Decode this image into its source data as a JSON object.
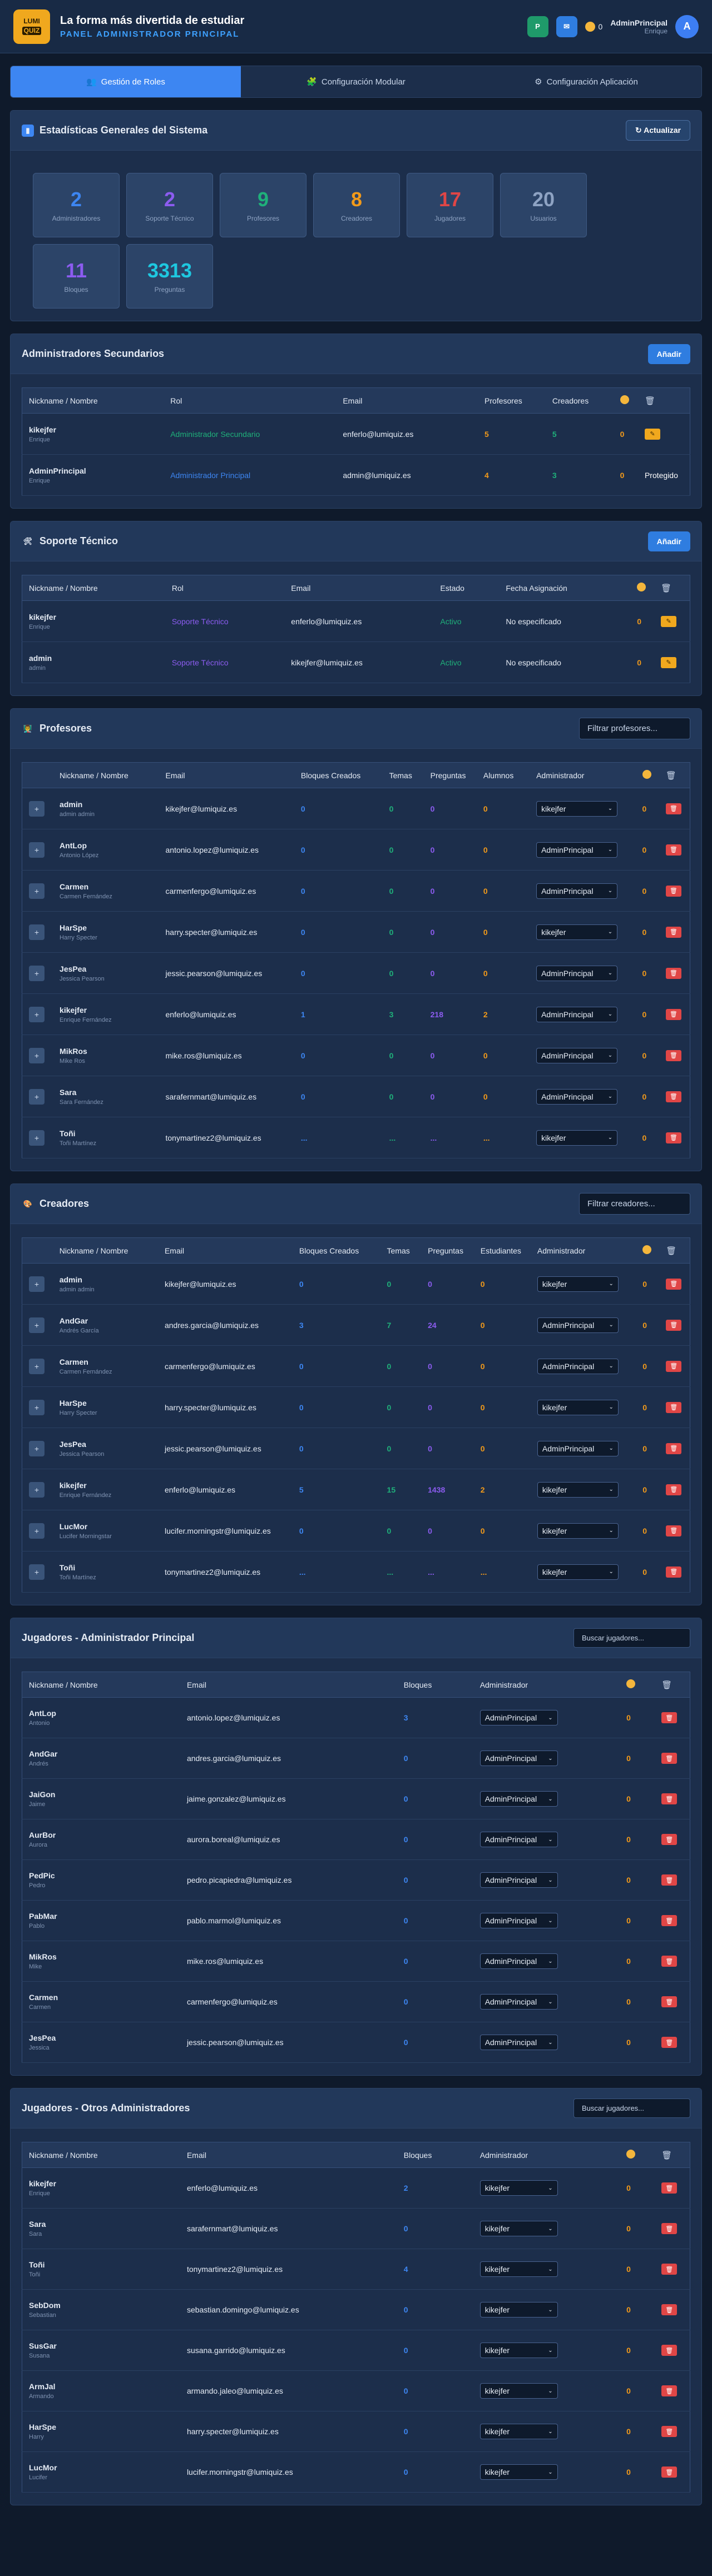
{
  "header": {
    "logo_line1": "LUMI",
    "logo_line2": "QUIZ",
    "slogan": "La forma más divertida de estudiar",
    "panel_label": "PANEL ADMINISTRADOR PRINCIPAL",
    "coins": "0",
    "user_name": "AdminPrincipal",
    "user_role": "Enrique",
    "avatar_letter": "A"
  },
  "tabs": [
    {
      "label": "Gestión de Roles",
      "icon": "users-icon"
    },
    {
      "label": "Configuración Modular",
      "icon": "modules-icon"
    },
    {
      "label": "Configuración Aplicación",
      "icon": "gear-icon"
    }
  ],
  "stats": {
    "title": "Estadísticas Generales del Sistema",
    "refresh": "Actualizar",
    "items": [
      {
        "value": "2",
        "label": "Administradores",
        "color": "#3d86f2"
      },
      {
        "value": "2",
        "label": "Soporte Técnico",
        "color": "#8c5cf0"
      },
      {
        "value": "9",
        "label": "Profesores",
        "color": "#1fb07a"
      },
      {
        "value": "8",
        "label": "Creadores",
        "color": "#f29a1a"
      },
      {
        "value": "17",
        "label": "Jugadores",
        "color": "#e04646"
      },
      {
        "value": "20",
        "label": "Usuarios",
        "color": "#8ea3c3"
      },
      {
        "value": "11",
        "label": "Bloques",
        "color": "#8c5cf0"
      },
      {
        "value": "3313",
        "label": "Preguntas",
        "color": "#1ec8e0"
      }
    ]
  },
  "admins": {
    "title": "Administradores Secundarios",
    "add": "Añadir",
    "cols": [
      "Nickname / Nombre",
      "Rol",
      "Email",
      "Profesores",
      "Creadores",
      "",
      ""
    ],
    "rows": [
      {
        "nick": "kikejfer",
        "name": "Enrique",
        "role": "Administrador Secundario",
        "email": "enferlo@lumiquiz.es",
        "prof": "5",
        "crea": "5",
        "coins": "0",
        "action": "edit"
      },
      {
        "nick": "AdminPrincipal",
        "name": "Enrique",
        "role": "Administrador Principal",
        "email": "admin@lumiquiz.es",
        "prof": "4",
        "crea": "3",
        "coins": "0",
        "action": "Protegido"
      }
    ]
  },
  "support": {
    "title": "Soporte Técnico",
    "add": "Añadir",
    "cols": [
      "Nickname / Nombre",
      "Rol",
      "Email",
      "Estado",
      "Fecha Asignación",
      "",
      ""
    ],
    "rows": [
      {
        "nick": "kikejfer",
        "name": "Enrique",
        "role": "Soporte Técnico",
        "email": "enferlo@lumiquiz.es",
        "state": "Activo",
        "date": "No especificado",
        "coins": "0"
      },
      {
        "nick": "admin",
        "name": "admin",
        "role": "Soporte Técnico",
        "email": "kikejfer@lumiquiz.es",
        "state": "Activo",
        "date": "No especificado",
        "coins": "0"
      }
    ]
  },
  "teachers": {
    "title": "Profesores",
    "filter": "Filtrar profesores...",
    "cols": [
      "",
      "Nickname / Nombre",
      "Email",
      "Bloques Creados",
      "Temas",
      "Preguntas",
      "Alumnos",
      "Administrador",
      "",
      ""
    ],
    "rows": [
      {
        "nick": "admin",
        "name": "admin admin",
        "email": "kikejfer@lumiquiz.es",
        "blocks": "0",
        "temas": "0",
        "preg": "0",
        "alum": "0",
        "admin": "kikejfer",
        "coins": "0"
      },
      {
        "nick": "AntLop",
        "name": "Antonio López",
        "email": "antonio.lopez@lumiquiz.es",
        "blocks": "0",
        "temas": "0",
        "preg": "0",
        "alum": "0",
        "admin": "AdminPrincipal",
        "coins": "0"
      },
      {
        "nick": "Carmen",
        "name": "Carmen Fernández",
        "email": "carmenfergo@lumiquiz.es",
        "blocks": "0",
        "temas": "0",
        "preg": "0",
        "alum": "0",
        "admin": "AdminPrincipal",
        "coins": "0"
      },
      {
        "nick": "HarSpe",
        "name": "Harry Specter",
        "email": "harry.specter@lumiquiz.es",
        "blocks": "0",
        "temas": "0",
        "preg": "0",
        "alum": "0",
        "admin": "kikejfer",
        "coins": "0"
      },
      {
        "nick": "JesPea",
        "name": "Jessica Pearson",
        "email": "jessic.pearson@lumiquiz.es",
        "blocks": "0",
        "temas": "0",
        "preg": "0",
        "alum": "0",
        "admin": "AdminPrincipal",
        "coins": "0"
      },
      {
        "nick": "kikejfer",
        "name": "Enrique Fernández",
        "email": "enferlo@lumiquiz.es",
        "blocks": "1",
        "temas": "3",
        "preg": "218",
        "alum": "2",
        "admin": "AdminPrincipal",
        "coins": "0"
      },
      {
        "nick": "MikRos",
        "name": "Mike Ros",
        "email": "mike.ros@lumiquiz.es",
        "blocks": "0",
        "temas": "0",
        "preg": "0",
        "alum": "0",
        "admin": "AdminPrincipal",
        "coins": "0"
      },
      {
        "nick": "Sara",
        "name": "Sara Fernández",
        "email": "sarafernmart@lumiquiz.es",
        "blocks": "0",
        "temas": "0",
        "preg": "0",
        "alum": "0",
        "admin": "AdminPrincipal",
        "coins": "0"
      },
      {
        "nick": "Toñi",
        "name": "Toñi Martínez",
        "email": "tonymartinez2@lumiquiz.es",
        "blocks": "...",
        "temas": "...",
        "preg": "...",
        "alum": "...",
        "admin": "kikejfer",
        "coins": "0"
      }
    ]
  },
  "creators": {
    "title": "Creadores",
    "filter": "Filtrar creadores...",
    "cols": [
      "",
      "Nickname / Nombre",
      "Email",
      "Bloques Creados",
      "Temas",
      "Preguntas",
      "Estudiantes",
      "Administrador",
      "",
      ""
    ],
    "rows": [
      {
        "nick": "admin",
        "name": "admin admin",
        "email": "kikejfer@lumiquiz.es",
        "blocks": "0",
        "temas": "0",
        "preg": "0",
        "alum": "0",
        "admin": "kikejfer",
        "coins": "0"
      },
      {
        "nick": "AndGar",
        "name": "Andrés García",
        "email": "andres.garcia@lumiquiz.es",
        "blocks": "3",
        "temas": "7",
        "preg": "24",
        "alum": "0",
        "admin": "AdminPrincipal",
        "coins": "0"
      },
      {
        "nick": "Carmen",
        "name": "Carmen Fernández",
        "email": "carmenfergo@lumiquiz.es",
        "blocks": "0",
        "temas": "0",
        "preg": "0",
        "alum": "0",
        "admin": "AdminPrincipal",
        "coins": "0"
      },
      {
        "nick": "HarSpe",
        "name": "Harry Specter",
        "email": "harry.specter@lumiquiz.es",
        "blocks": "0",
        "temas": "0",
        "preg": "0",
        "alum": "0",
        "admin": "kikejfer",
        "coins": "0"
      },
      {
        "nick": "JesPea",
        "name": "Jessica Pearson",
        "email": "jessic.pearson@lumiquiz.es",
        "blocks": "0",
        "temas": "0",
        "preg": "0",
        "alum": "0",
        "admin": "AdminPrincipal",
        "coins": "0"
      },
      {
        "nick": "kikejfer",
        "name": "Enrique Fernández",
        "email": "enferlo@lumiquiz.es",
        "blocks": "5",
        "temas": "15",
        "preg": "1438",
        "alum": "2",
        "admin": "kikejfer",
        "coins": "0"
      },
      {
        "nick": "LucMor",
        "name": "Lucifer Morningstar",
        "email": "lucifer.morningstr@lumiquiz.es",
        "blocks": "0",
        "temas": "0",
        "preg": "0",
        "alum": "0",
        "admin": "kikejfer",
        "coins": "0"
      },
      {
        "nick": "Toñi",
        "name": "Toñi Martínez",
        "email": "tonymartinez2@lumiquiz.es",
        "blocks": "...",
        "temas": "...",
        "preg": "...",
        "alum": "...",
        "admin": "kikejfer",
        "coins": "0"
      }
    ]
  },
  "players_main": {
    "title": "Jugadores - Administrador Principal",
    "filter": "Buscar jugadores...",
    "cols": [
      "Nickname / Nombre",
      "Email",
      "Bloques",
      "Administrador",
      "",
      ""
    ],
    "rows": [
      {
        "nick": "AntLop",
        "name": "Antonio",
        "email": "antonio.lopez@lumiquiz.es",
        "blocks": "3",
        "admin": "AdminPrincipal",
        "coins": "0"
      },
      {
        "nick": "AndGar",
        "name": "Andrés",
        "email": "andres.garcia@lumiquiz.es",
        "blocks": "0",
        "admin": "AdminPrincipal",
        "coins": "0"
      },
      {
        "nick": "JaiGon",
        "name": "Jaime",
        "email": "jaime.gonzalez@lumiquiz.es",
        "blocks": "0",
        "admin": "AdminPrincipal",
        "coins": "0"
      },
      {
        "nick": "AurBor",
        "name": "Aurora",
        "email": "aurora.boreal@lumiquiz.es",
        "blocks": "0",
        "admin": "AdminPrincipal",
        "coins": "0"
      },
      {
        "nick": "PedPic",
        "name": "Pedro",
        "email": "pedro.picapiedra@lumiquiz.es",
        "blocks": "0",
        "admin": "AdminPrincipal",
        "coins": "0"
      },
      {
        "nick": "PabMar",
        "name": "Pablo",
        "email": "pablo.marmol@lumiquiz.es",
        "blocks": "0",
        "admin": "AdminPrincipal",
        "coins": "0"
      },
      {
        "nick": "MikRos",
        "name": "Mike",
        "email": "mike.ros@lumiquiz.es",
        "blocks": "0",
        "admin": "AdminPrincipal",
        "coins": "0"
      },
      {
        "nick": "Carmen",
        "name": "Carmen",
        "email": "carmenfergo@lumiquiz.es",
        "blocks": "0",
        "admin": "AdminPrincipal",
        "coins": "0"
      },
      {
        "nick": "JesPea",
        "name": "Jessica",
        "email": "jessic.pearson@lumiquiz.es",
        "blocks": "0",
        "admin": "AdminPrincipal",
        "coins": "0"
      }
    ]
  },
  "players_other": {
    "title": "Jugadores - Otros Administradores",
    "filter": "Buscar jugadores...",
    "cols": [
      "Nickname / Nombre",
      "Email",
      "Bloques",
      "Administrador",
      "",
      ""
    ],
    "rows": [
      {
        "nick": "kikejfer",
        "name": "Enrique",
        "email": "enferlo@lumiquiz.es",
        "blocks": "2",
        "admin": "kikejfer",
        "coins": "0"
      },
      {
        "nick": "Sara",
        "name": "Sara",
        "email": "sarafernmart@lumiquiz.es",
        "blocks": "0",
        "admin": "kikejfer",
        "coins": "0"
      },
      {
        "nick": "Toñi",
        "name": "Toñi",
        "email": "tonymartinez2@lumiquiz.es",
        "blocks": "4",
        "admin": "kikejfer",
        "coins": "0"
      },
      {
        "nick": "SebDom",
        "name": "Sebastian",
        "email": "sebastian.domingo@lumiquiz.es",
        "blocks": "0",
        "admin": "kikejfer",
        "coins": "0"
      },
      {
        "nick": "SusGar",
        "name": "Susana",
        "email": "susana.garrido@lumiquiz.es",
        "blocks": "0",
        "admin": "kikejfer",
        "coins": "0"
      },
      {
        "nick": "ArmJal",
        "name": "Armando",
        "email": "armando.jaleo@lumiquiz.es",
        "blocks": "0",
        "admin": "kikejfer",
        "coins": "0"
      },
      {
        "nick": "HarSpe",
        "name": "Harry",
        "email": "harry.specter@lumiquiz.es",
        "blocks": "0",
        "admin": "kikejfer",
        "coins": "0"
      },
      {
        "nick": "LucMor",
        "name": "Lucifer",
        "email": "lucifer.morningstr@lumiquiz.es",
        "blocks": "0",
        "admin": "kikejfer",
        "coins": "0"
      }
    ]
  }
}
